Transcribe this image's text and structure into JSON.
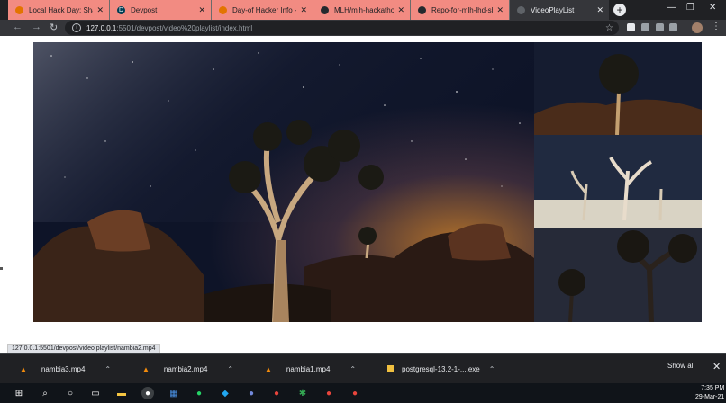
{
  "tabs": [
    {
      "title": "Local Hack Day: Share",
      "favicon": "mlh-icon",
      "active": false
    },
    {
      "title": "Devpost",
      "favicon": "devpost-icon",
      "active": false
    },
    {
      "title": "Day-of Hacker Info - M",
      "favicon": "mlh-icon",
      "active": false
    },
    {
      "title": "MLH/mlh-hackathon-fl",
      "favicon": "github-icon",
      "active": false
    },
    {
      "title": "Repo-for-mlh-lhd-sha",
      "favicon": "github-icon",
      "active": false
    },
    {
      "title": "VideoPlayList",
      "favicon": "globe-icon",
      "active": true
    }
  ],
  "address_bar": {
    "host": "127.0.0.1",
    "path": ":5501/devpost/video%20playlist/index.html"
  },
  "status_url": "127.0.0.1:5501/devpost/video playlist/nambia2.mp4",
  "downloads": {
    "items": [
      {
        "name": "nambia3.mp4",
        "icon": "vlc-icon"
      },
      {
        "name": "nambia2.mp4",
        "icon": "vlc-icon"
      },
      {
        "name": "nambia1.mp4",
        "icon": "vlc-icon"
      },
      {
        "name": "postgresql-13.2-1-....exe",
        "icon": "installer-icon"
      }
    ],
    "show_all_label": "Show all"
  },
  "taskbar": {
    "time": "7:35 PM",
    "date": "29-Mar-21"
  },
  "colors": {
    "tab_inactive": "#f28b82",
    "tab_active": "#35363a",
    "chrome_dark": "#202124"
  }
}
